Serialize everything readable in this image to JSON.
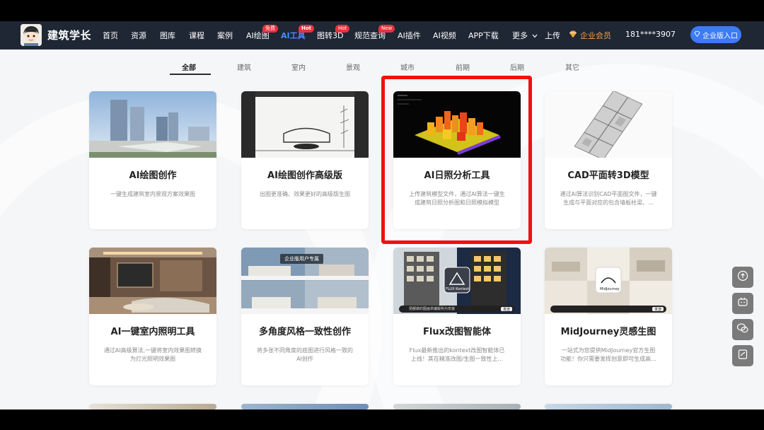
{
  "brand": {
    "name": "建筑学长"
  },
  "nav": {
    "items": [
      {
        "label": "首页"
      },
      {
        "label": "资源"
      },
      {
        "label": "图库"
      },
      {
        "label": "课程"
      },
      {
        "label": "案例"
      },
      {
        "label": "AI绘图",
        "badge": "免费"
      },
      {
        "label": "AI工具",
        "badge": "Hot",
        "active": true
      },
      {
        "label": "图转3D",
        "badge": "Hot"
      },
      {
        "label": "规范查询",
        "badge": "New"
      },
      {
        "label": "AI插件"
      },
      {
        "label": "AI视频"
      },
      {
        "label": "APP下载"
      },
      {
        "label": "更多"
      },
      {
        "label": "上传"
      }
    ],
    "vip_label": "企业会员",
    "phone": "181****3907",
    "enterprise_button": "企业版入口"
  },
  "tabs": [
    "全部",
    "建筑",
    "室内",
    "景观",
    "城市",
    "前期",
    "后期",
    "其它"
  ],
  "active_tab": "全部",
  "cards": [
    {
      "title": "AI绘图创作",
      "desc": "一键生成建筑室内景观方案效果图"
    },
    {
      "title": "AI绘图创作高级版",
      "desc": "出图更准确、效果更好的高级版生图"
    },
    {
      "title": "AI日照分析工具",
      "desc": "上传建筑模型文件，通过AI算法一键生成建筑日照分析图和日照模拟模型"
    },
    {
      "title": "CAD平面转3D模型",
      "desc": "通过AI算法识别CAD平面图文件，一键生成与平面对应的包含墙板柱梁、..."
    },
    {
      "title": "AI一键室内照明工具",
      "desc": "通过AI高级算法,一键将室内效果图转换为灯光照明效果图"
    },
    {
      "title": "多角度风格一致性创作",
      "desc": "将多张不同角度的底图进行风格一致的AI创作",
      "tag": "企业版用户专属"
    },
    {
      "title": "Flux改图智能体",
      "desc": "Flux最新推出的kontext改图智能体已上线！其在精准改图/生图一致性上...",
      "thumb_label": "FLUX Kontext",
      "thumb_prompt": "把都做的图画单编版构为安装",
      "thumb_button": "发送"
    },
    {
      "title": "MidJourney灵感生图",
      "desc": "一站式为您提供MidJourney官方生图功能！你只需要发挥创意即可生成高...",
      "thumb_label": "MidJourney",
      "thumb_button": "发送"
    }
  ],
  "colors": {
    "nav_bg": "#1f2634",
    "accent": "#3d7bf5",
    "vip": "#f0a23a",
    "highlight": "#f21010",
    "badge": "#e8323c"
  },
  "side_buttons": [
    "upload-icon",
    "bilibili-icon",
    "wechat-icon",
    "feedback-icon"
  ]
}
